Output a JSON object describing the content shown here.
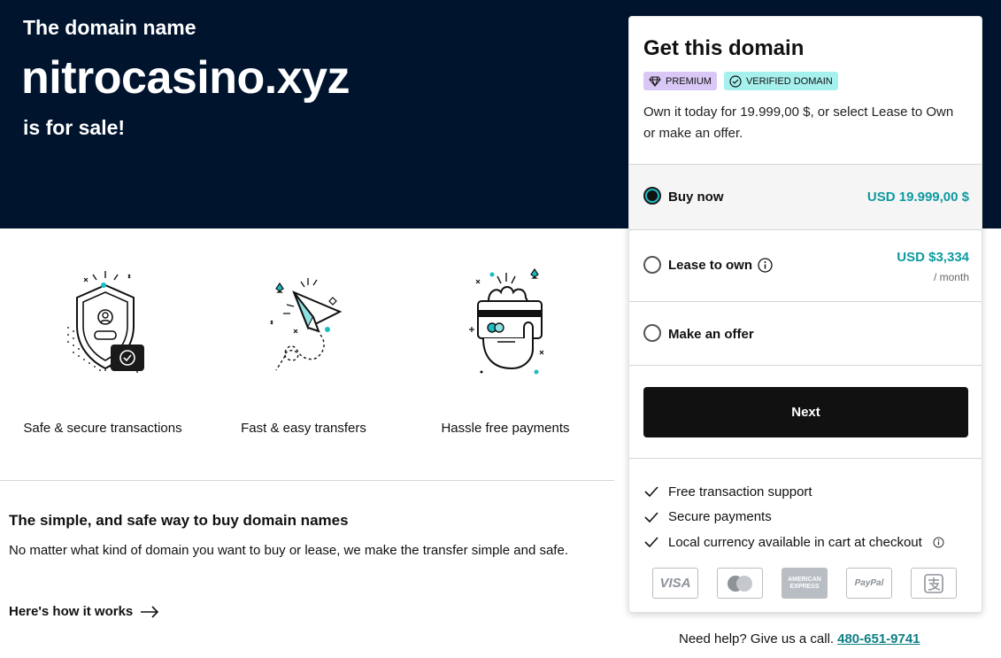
{
  "hero": {
    "kicker": "The domain name",
    "domain": "nitrocasino.xyz",
    "subtitle": "is for sale!"
  },
  "features": [
    {
      "label": "Safe & secure transactions",
      "icon": "shield-check-icon"
    },
    {
      "label": "Fast & easy transfers",
      "icon": "paper-plane-icon"
    },
    {
      "label": "Hassle free payments",
      "icon": "hand-card-icon"
    }
  ],
  "info": {
    "title": "The simple, and safe way to buy domain names",
    "text": "No matter what kind of domain you want to buy or lease, we make the transfer simple and safe.",
    "link": "Here's how it works"
  },
  "card": {
    "title": "Get this domain",
    "badges": [
      "PREMIUM",
      "VERIFIED DOMAIN"
    ],
    "description": "Own it today for 19.999,00 $, or select Lease to Own or make an offer.",
    "options": [
      {
        "label": "Buy now",
        "price": "USD 19.999,00 $",
        "selected": true
      },
      {
        "label": "Lease to own",
        "price": "USD $3,334",
        "period": "/ month",
        "selected": false
      },
      {
        "label": "Make an offer",
        "selected": false
      }
    ],
    "next_label": "Next",
    "perks": [
      "Free transaction support",
      "Secure payments",
      "Local currency available in cart at checkout"
    ],
    "payment_methods": [
      "VISA",
      "Mastercard",
      "AMERICAN EXPRESS",
      "PayPal",
      "Alipay"
    ]
  },
  "help": {
    "text": "Need help? Give us a call.",
    "phone": "480-651-9741"
  },
  "colors": {
    "hero_bg": "#00142e",
    "accent": "#0e9aa0",
    "button": "#111111"
  }
}
